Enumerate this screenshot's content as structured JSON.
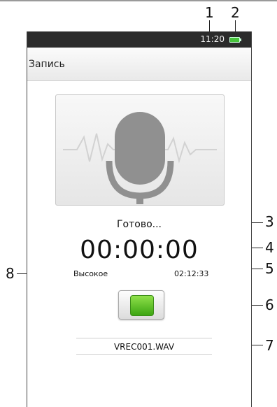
{
  "callouts": [
    "1",
    "2",
    "3",
    "4",
    "5",
    "6",
    "7",
    "8"
  ],
  "statusbar": {
    "time": "11:20"
  },
  "app": {
    "title": "Запись"
  },
  "recorder": {
    "status": "Готово...",
    "timer": "00:00:00",
    "quality": "Высокое",
    "remaining": "02:12:33",
    "filename": "VREC001.WAV"
  },
  "colors": {
    "accent_green": "#48c43c",
    "statusbar": "#2b2b2b"
  },
  "icons": {
    "mic": "microphone-icon",
    "battery": "battery-icon",
    "stop": "stop-icon"
  }
}
